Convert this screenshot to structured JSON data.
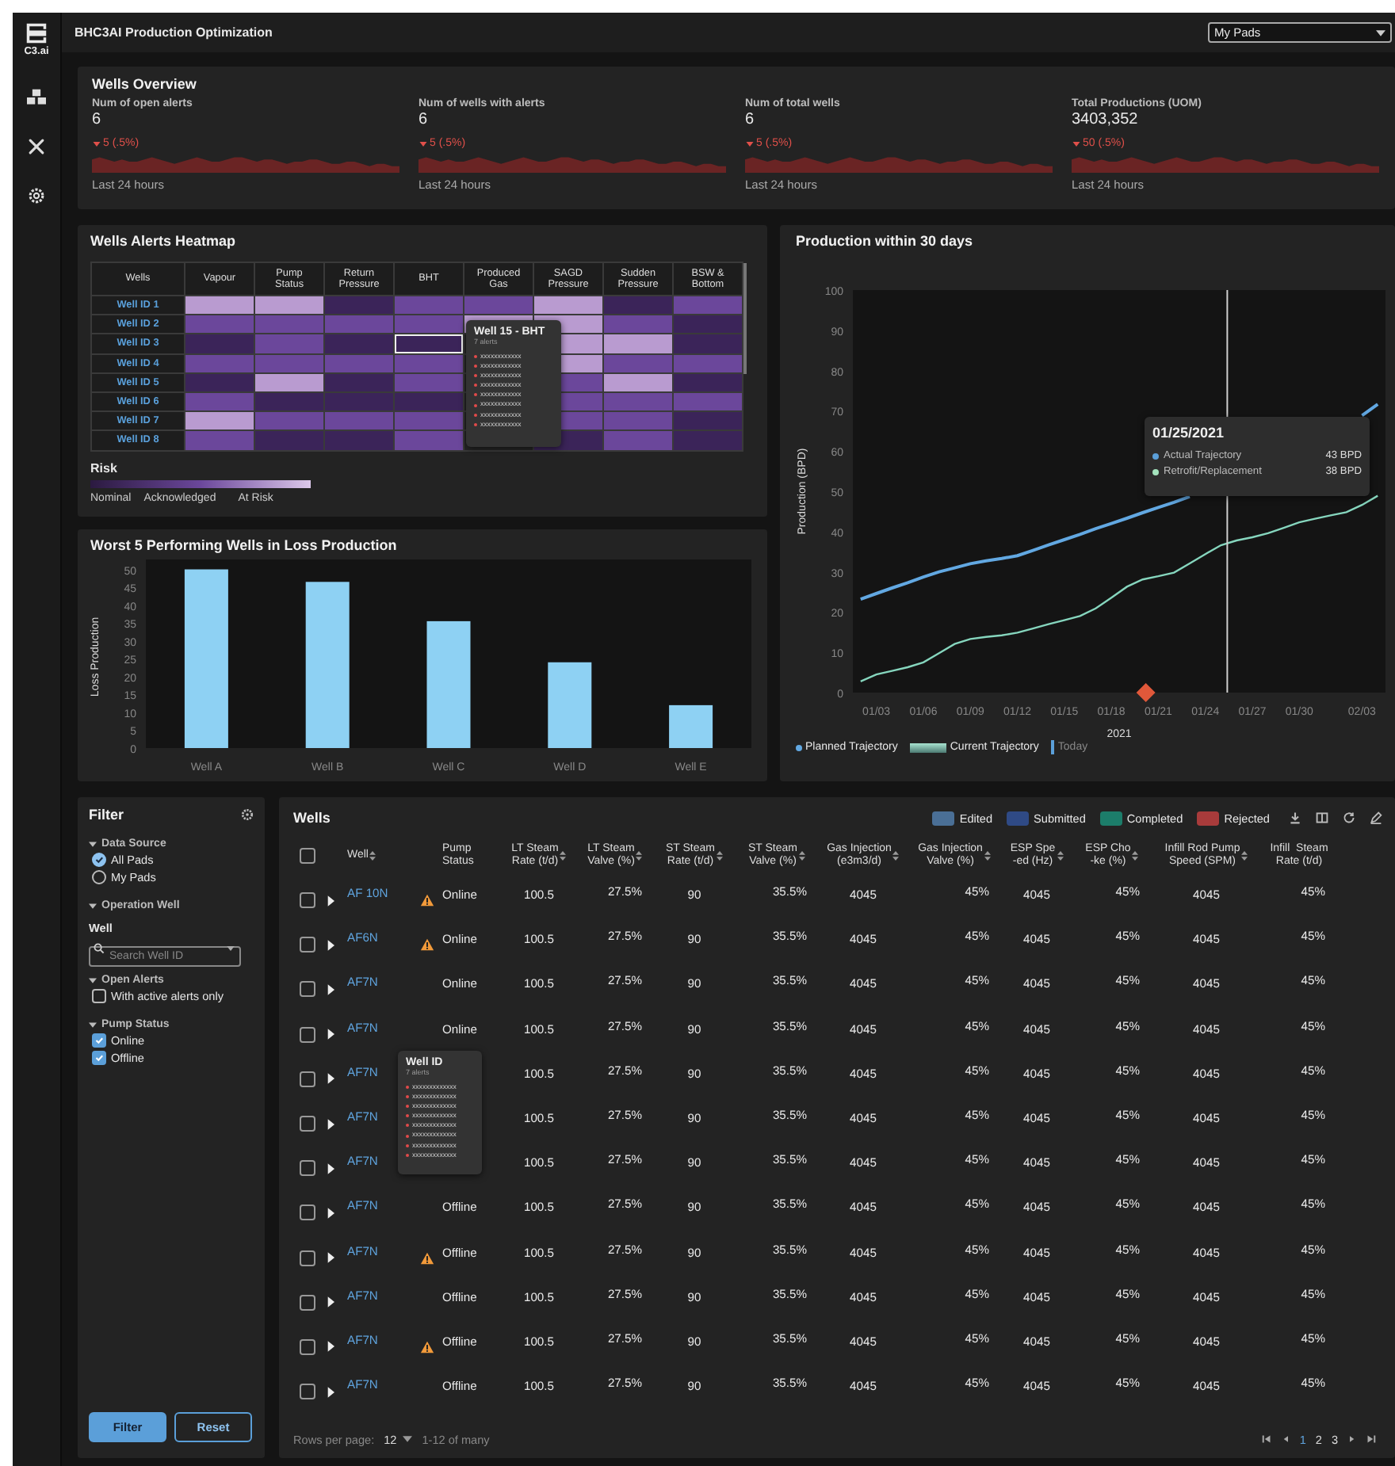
{
  "app": {
    "logo_text": "C3.ai",
    "title": "BHC3AI Production Optimization",
    "pad_select": "My Pads"
  },
  "overview": {
    "title": "Wells Overview",
    "metrics": [
      {
        "label": "Num of open alerts",
        "value": "6",
        "change": "5 (.5%)",
        "period": "Last 24 hours"
      },
      {
        "label": "Num of wells with alerts",
        "value": "6",
        "change": "5 (.5%)",
        "period": "Last 24 hours"
      },
      {
        "label": "Num of total wells",
        "value": "6",
        "change": "5 (.5%)",
        "period": "Last 24 hours"
      },
      {
        "label": "Total Productions (UOM)",
        "value": "3403,352",
        "change": "50 (.5%)",
        "period": "Last 24 hours"
      }
    ]
  },
  "heatmap": {
    "title": "Wells Alerts Heatmap",
    "row_header": "Wells",
    "columns": [
      "Vapour",
      "Pump\nStatus",
      "Return\nPressure",
      "BHT",
      "Produced\nGas",
      "SAGD\nPressure",
      "Sudden\nPressure",
      "BSW &\nBottom"
    ],
    "rows": [
      {
        "well": "Well ID 1",
        "cells": [
          {
            "color": "#b99bd0",
            "selected": false
          },
          {
            "color": "#b99bd0",
            "selected": false
          },
          {
            "color": "#3b2459",
            "selected": false
          },
          {
            "color": "#6b479b",
            "selected": false
          },
          {
            "color": "#6b479b",
            "selected": false
          },
          {
            "color": "#b99bd0",
            "selected": false
          },
          {
            "color": "#3b2459",
            "selected": false
          },
          {
            "color": "#6b479b",
            "selected": false
          }
        ]
      },
      {
        "well": "Well ID 2",
        "cells": [
          {
            "color": "#6b479b",
            "selected": false
          },
          {
            "color": "#6b479b",
            "selected": false
          },
          {
            "color": "#6b479b",
            "selected": false
          },
          {
            "color": "#6b479b",
            "selected": false
          },
          {
            "color": "#b99bd0",
            "selected": false
          },
          {
            "color": "#b99bd0",
            "selected": false
          },
          {
            "color": "#6b479b",
            "selected": false
          },
          {
            "color": "#3b2459",
            "selected": false
          }
        ]
      },
      {
        "well": "Well ID 3",
        "cells": [
          {
            "color": "#3b2459",
            "selected": false
          },
          {
            "color": "#6b479b",
            "selected": false
          },
          {
            "color": "#3b2459",
            "selected": false
          },
          {
            "color": "#3b2459",
            "selected": true
          },
          null,
          {
            "color": "#b99bd0",
            "selected": false
          },
          {
            "color": "#b99bd0",
            "selected": false
          },
          {
            "color": "#3b2459",
            "selected": false
          }
        ]
      },
      {
        "well": "Well ID 4",
        "cells": [
          {
            "color": "#6b479b",
            "selected": false
          },
          {
            "color": "#6b479b",
            "selected": false
          },
          {
            "color": "#6b479b",
            "selected": false
          },
          {
            "color": "#6b479b",
            "selected": false
          },
          null,
          {
            "color": "#b99bd0",
            "selected": false
          },
          {
            "color": "#6b479b",
            "selected": false
          },
          {
            "color": "#6b479b",
            "selected": false
          }
        ]
      },
      {
        "well": "Well ID 5",
        "cells": [
          {
            "color": "#3b2459",
            "selected": false
          },
          {
            "color": "#b99bd0",
            "selected": false
          },
          {
            "color": "#3b2459",
            "selected": false
          },
          {
            "color": "#6b479b",
            "selected": false
          },
          null,
          {
            "color": "#6b479b",
            "selected": false
          },
          {
            "color": "#b99bd0",
            "selected": false
          },
          {
            "color": "#3b2459",
            "selected": false
          }
        ]
      },
      {
        "well": "Well ID 6",
        "cells": [
          {
            "color": "#6b479b",
            "selected": false
          },
          {
            "color": "#3b2459",
            "selected": false
          },
          {
            "color": "#3b2459",
            "selected": false
          },
          {
            "color": "#3b2459",
            "selected": false
          },
          null,
          {
            "color": "#6b479b",
            "selected": false
          },
          {
            "color": "#6b479b",
            "selected": false
          },
          {
            "color": "#6b479b",
            "selected": false
          }
        ]
      },
      {
        "well": "Well ID 7",
        "cells": [
          {
            "color": "#b99bd0",
            "selected": false
          },
          {
            "color": "#6b479b",
            "selected": false
          },
          {
            "color": "#6b479b",
            "selected": false
          },
          {
            "color": "#6b479b",
            "selected": false
          },
          null,
          {
            "color": "#6b479b",
            "selected": false
          },
          {
            "color": "#6b479b",
            "selected": false
          },
          {
            "color": "#3b2459",
            "selected": false
          }
        ]
      },
      {
        "well": "Well ID 8",
        "cells": [
          {
            "color": "#6b479b",
            "selected": false
          },
          {
            "color": "#3b2459",
            "selected": false
          },
          {
            "color": "#3b2459",
            "selected": false
          },
          {
            "color": "#6b479b",
            "selected": false
          },
          null,
          {
            "color": "#3b2459",
            "selected": false
          },
          {
            "color": "#6b479b",
            "selected": false
          },
          {
            "color": "#3b2459",
            "selected": false
          }
        ]
      }
    ],
    "tooltip": {
      "title": "Well 15 - BHT",
      "subtitle": "7 alerts",
      "lines": [
        "xxxxxxxxxxxx",
        "xxxxxxxxxxxx",
        "xxxxxxxxxxxx",
        "xxxxxxxxxxxx",
        "xxxxxxxxxxxx",
        "xxxxxxxxxxxx",
        "xxxxxxxxxxxx",
        "xxxxxxxxxxxx"
      ]
    },
    "legend": {
      "title": "Risk",
      "labels": [
        "Nominal",
        "Acknowledged",
        "At Risk"
      ]
    }
  },
  "loss_panel": {
    "chart_data": {
      "type": "bar",
      "title": "Worst 5 Performing Wells in Loss Production",
      "ylabel": "Loss Production",
      "categories": [
        "Well A",
        "Well B",
        "Well C",
        "Well D",
        "Well E"
      ],
      "series": [
        {
          "color": "#8ed1f3",
          "values": [
            50,
            46.5,
            35.5,
            24,
            12
          ]
        }
      ],
      "ylim": [
        0,
        51
      ],
      "yticks": [
        0,
        5,
        10,
        15,
        20,
        25,
        30,
        35,
        40,
        45,
        50
      ]
    }
  },
  "production_panel": {
    "chart_data": {
      "type": "line",
      "title": "Production within 30 days",
      "xlabel": "2021",
      "ylabel": "Production (BPD)",
      "categories": [
        null,
        "01/03",
        null,
        null,
        "01/06",
        null,
        null,
        "01/09",
        null,
        null,
        "01/12",
        null,
        null,
        "01/15",
        null,
        null,
        "01/18",
        null,
        null,
        "01/21",
        null,
        null,
        "01/24",
        null,
        null,
        "01/27",
        null,
        null,
        "01/30",
        null,
        null,
        null,
        "02/03",
        null
      ],
      "series": [
        {
          "name": "Planned Trajectory",
          "color": "#62a8e2",
          "values": [
            23.2,
            24.6,
            26,
            27.3,
            28.7,
            30,
            31,
            32,
            32.7,
            33.3,
            34,
            35.3,
            36.7,
            38,
            39.3,
            40.7,
            42,
            43.3,
            44.7,
            46,
            47.3,
            48.7,
            null,
            null,
            null,
            null,
            null,
            null,
            null,
            null,
            null,
            null,
            68.8,
            71.6
          ]
        },
        {
          "name": "Current Trajectory",
          "color": "#86d6be",
          "values": [
            2.8,
            4.5,
            5.4,
            6.3,
            7.5,
            9.8,
            12.1,
            13.3,
            13.8,
            14.2,
            14.9,
            15.9,
            17,
            18,
            19,
            20.9,
            23.6,
            26.3,
            28.1,
            28.9,
            29.8,
            32.1,
            34.4,
            36.6,
            37.8,
            38.6,
            39.6,
            40.9,
            42.3,
            43.2,
            44,
            44.8,
            46.6,
            48.9
          ]
        }
      ],
      "ylim": [
        0,
        100
      ],
      "yticks": [
        0,
        10,
        20,
        30,
        40,
        50,
        60,
        70,
        80,
        90,
        100
      ]
    },
    "tooltip": {
      "date": "01/25/2021",
      "items": [
        {
          "label": "Actual Trajectory",
          "value": "43 BPD",
          "color": "#5b9fd9"
        },
        {
          "label": "Retrofit/Replacement",
          "value": "38 BPD",
          "color": "#a4e3bd"
        }
      ]
    },
    "today_label": "Today"
  },
  "filter": {
    "title": "Filter",
    "sections": [
      {
        "kind": "radio",
        "title": "Data Source",
        "expanded": true,
        "options": [
          {
            "label": "All Pads",
            "selected": true
          },
          {
            "label": "My Pads",
            "selected": false
          }
        ]
      },
      {
        "kind": "search",
        "title": "Operation Well",
        "expanded": true,
        "field_label": "Well",
        "placeholder": "Search Well ID"
      },
      {
        "kind": "checkbox",
        "title": "Open Alerts",
        "expanded": true,
        "options": [
          {
            "label": "With active alerts only",
            "checked": false
          }
        ]
      },
      {
        "kind": "checkbox",
        "title": "Pump Status",
        "expanded": true,
        "options": [
          {
            "label": "Online",
            "checked": true
          },
          {
            "label": "Offline",
            "checked": true
          }
        ]
      }
    ],
    "buttons": [
      {
        "label": "Filter",
        "kind": "primary"
      },
      {
        "label": "Reset",
        "kind": "secondary"
      }
    ]
  },
  "table": {
    "title": "Wells",
    "legend": [
      {
        "label": "Edited",
        "color": "#4a6f96"
      },
      {
        "label": "Submitted",
        "color": "#2f4a85"
      },
      {
        "label": "Completed",
        "color": "#1c7d6a"
      },
      {
        "label": "Rejected",
        "color": "#a83b3b"
      }
    ],
    "select_all_checked": false,
    "columns": [
      {
        "label": "Well",
        "sortable": true
      },
      {
        "label": "Pump\nStatus",
        "sortable": false
      },
      {
        "label": "LT Steam\nRate (t/d)",
        "sortable": true
      },
      {
        "label": "LT Steam\nValve (%)",
        "sortable": true
      },
      {
        "label": "ST Steam\nRate (t/d)",
        "sortable": true
      },
      {
        "label": "ST Steam\nValve (%)",
        "sortable": true
      },
      {
        "label": "Gas Injection\n(e3m3/d)",
        "sortable": true
      },
      {
        "label": "Gas Injection\nValve (%)",
        "sortable": true
      },
      {
        "label": "ESP Spe\n-ed (Hz)",
        "sortable": true
      },
      {
        "label": "ESP Cho\n-ke (%)",
        "sortable": true
      },
      {
        "label": "Infill Rod Pump\nSpeed (SPM)",
        "sortable": true
      },
      {
        "label": "Infill  Steam\nRate (t/d)",
        "sortable": false
      }
    ],
    "rows": [
      {
        "checked": false,
        "expanded": false,
        "well": "AF 10N",
        "alert": true,
        "pump_status": "Online",
        "values": [
          "100.5",
          "27.5%",
          "90",
          "35.5%",
          "4045",
          "45%",
          "4045",
          "45%",
          "4045",
          "45%"
        ]
      },
      {
        "checked": false,
        "expanded": false,
        "well": "AF6N",
        "alert": true,
        "pump_status": "Online",
        "values": [
          "100.5",
          "27.5%",
          "90",
          "35.5%",
          "4045",
          "45%",
          "4045",
          "45%",
          "4045",
          "45%"
        ]
      },
      {
        "checked": false,
        "expanded": false,
        "well": "AF7N",
        "alert": false,
        "pump_status": "Online",
        "values": [
          "100.5",
          "27.5%",
          "90",
          "35.5%",
          "4045",
          "45%",
          "4045",
          "45%",
          "4045",
          "45%"
        ]
      },
      {
        "checked": false,
        "expanded": false,
        "well": "AF7N",
        "alert": false,
        "pump_status": "Online",
        "values": [
          "100.5",
          "27.5%",
          "90",
          "35.5%",
          "4045",
          "45%",
          "4045",
          "45%",
          "4045",
          "45%"
        ]
      },
      {
        "checked": false,
        "expanded": false,
        "well": "AF7N",
        "values": [
          "100.5",
          "27.5%",
          "90",
          "35.5%",
          "4045",
          "45%",
          "4045",
          "45%",
          "4045",
          "45%"
        ]
      },
      {
        "checked": false,
        "expanded": false,
        "well": "AF7N",
        "values": [
          "100.5",
          "27.5%",
          "90",
          "35.5%",
          "4045",
          "45%",
          "4045",
          "45%",
          "4045",
          "45%"
        ]
      },
      {
        "checked": false,
        "expanded": false,
        "well": "AF7N",
        "values": [
          "100.5",
          "27.5%",
          "90",
          "35.5%",
          "4045",
          "45%",
          "4045",
          "45%",
          "4045",
          "45%"
        ]
      },
      {
        "checked": false,
        "expanded": false,
        "well": "AF7N",
        "alert": false,
        "pump_status": "Offline",
        "values": [
          "100.5",
          "27.5%",
          "90",
          "35.5%",
          "4045",
          "45%",
          "4045",
          "45%",
          "4045",
          "45%"
        ]
      },
      {
        "checked": false,
        "expanded": false,
        "well": "AF7N",
        "alert": true,
        "pump_status": "Offline",
        "values": [
          "100.5",
          "27.5%",
          "90",
          "35.5%",
          "4045",
          "45%",
          "4045",
          "45%",
          "4045",
          "45%"
        ]
      },
      {
        "checked": false,
        "expanded": false,
        "well": "AF7N",
        "alert": false,
        "pump_status": "Offline",
        "values": [
          "100.5",
          "27.5%",
          "90",
          "35.5%",
          "4045",
          "45%",
          "4045",
          "45%",
          "4045",
          "45%"
        ]
      },
      {
        "checked": false,
        "expanded": false,
        "well": "AF7N",
        "alert": true,
        "pump_status": "Offline",
        "values": [
          "100.5",
          "27.5%",
          "90",
          "35.5%",
          "4045",
          "45%",
          "4045",
          "45%",
          "4045",
          "45%"
        ]
      },
      {
        "checked": false,
        "expanded": false,
        "well": "AF7N",
        "alert": false,
        "pump_status": "Offline",
        "values": [
          "100.5",
          "27.5%",
          "90",
          "35.5%",
          "4045",
          "45%",
          "4045",
          "45%",
          "4045",
          "45%"
        ]
      }
    ],
    "tooltip": {
      "title": "Well ID",
      "subtitle": "7 alerts",
      "lines": [
        "xxxxxxxxxxxxx",
        "xxxxxxxxxxxxx",
        "xxxxxxxxxxxxx",
        "xxxxxxxxxxxxx",
        "xxxxxxxxxxxxx",
        "xxxxxxxxxxxxx",
        "xxxxxxxxxxxxx",
        "xxxxxxxxxxxxx"
      ]
    },
    "footer": {
      "rows_per_page_label": "Rows per page:",
      "rows_per_page": "12",
      "range": "1-12 of many",
      "pages": [
        {
          "label": "1",
          "selected": true
        },
        {
          "label": "2",
          "selected": false
        },
        {
          "label": "3",
          "selected": false
        }
      ]
    }
  }
}
